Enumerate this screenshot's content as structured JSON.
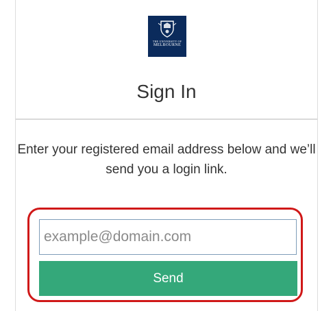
{
  "logo": {
    "line1": "THE UNIVERSITY OF",
    "line2": "MELBOURNE",
    "background": "#0b2b5c"
  },
  "signin": {
    "title": "Sign In",
    "instructions": "Enter your registered email address below and we’ll send you a login link.",
    "email_placeholder": "example@domain.com",
    "email_value": "",
    "send_label": "Send"
  },
  "colors": {
    "send_button": "#34a87a",
    "highlight": "#d01818",
    "text": "#333333"
  }
}
